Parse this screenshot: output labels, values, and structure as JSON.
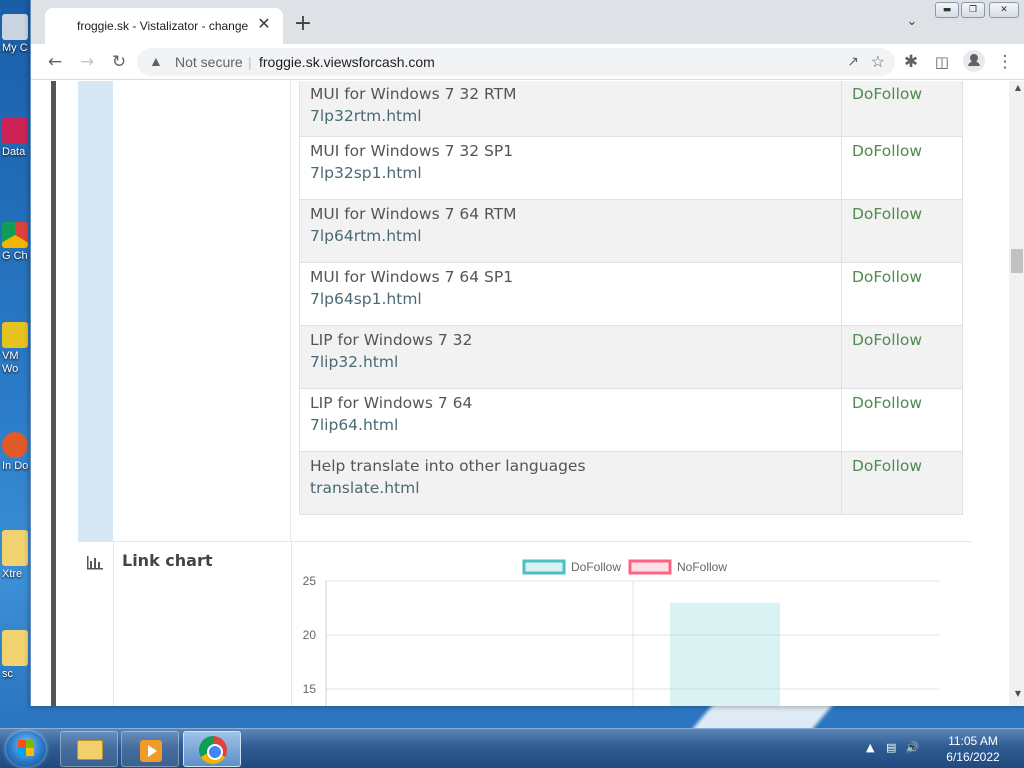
{
  "browser": {
    "tab_title": "froggie.sk - Vistalizator - change",
    "tab_close": "✕",
    "new_tab": "+",
    "security_label": "Not secure",
    "separator": "|",
    "url": "froggie.sk.viewsforcash.com"
  },
  "links_table": {
    "rows": [
      {
        "name": "MUI for Windows 7 32 RTM",
        "file": "7lp32rtm.html",
        "follow": "DoFollow"
      },
      {
        "name": "MUI for Windows 7 32 SP1",
        "file": "7lp32sp1.html",
        "follow": "DoFollow"
      },
      {
        "name": "MUI for Windows 7 64 RTM",
        "file": "7lp64rtm.html",
        "follow": "DoFollow"
      },
      {
        "name": "MUI for Windows 7 64 SP1",
        "file": "7lp64sp1.html",
        "follow": "DoFollow"
      },
      {
        "name": "LIP for Windows 7 32",
        "file": "7lip32.html",
        "follow": "DoFollow"
      },
      {
        "name": "LIP for Windows 7 64",
        "file": "7lip64.html",
        "follow": "DoFollow"
      },
      {
        "name": "Help translate into other languages",
        "file": "translate.html",
        "follow": "DoFollow"
      }
    ]
  },
  "link_chart": {
    "heading": "Link chart"
  },
  "chart_data": {
    "type": "bar",
    "title": "",
    "xlabel": "",
    "ylabel": "",
    "y_ticks_visible": [
      25,
      20,
      15
    ],
    "ylim_visible": [
      14,
      25
    ],
    "series": [
      {
        "name": "DoFollow",
        "color": "#4bc0c0",
        "values": [
          23
        ]
      },
      {
        "name": "NoFollow",
        "color": "#ff6384",
        "values": []
      }
    ],
    "legend": "top",
    "grid": true
  },
  "desktop": {
    "icons": [
      {
        "label": "My C",
        "icon": "computer-icon"
      },
      {
        "label": "Data",
        "icon": "database-icon"
      },
      {
        "label": "G Ch",
        "icon": "chrome-shortcut-icon"
      },
      {
        "label": "VM Wo",
        "icon": "vm-icon"
      },
      {
        "label": "In Do",
        "icon": "download-icon"
      },
      {
        "label": "Xtre",
        "icon": "folder-icon"
      },
      {
        "label": "sc",
        "icon": "folder-icon"
      }
    ]
  },
  "taskbar": {
    "time": "11:05 AM",
    "date": "6/16/2022"
  }
}
